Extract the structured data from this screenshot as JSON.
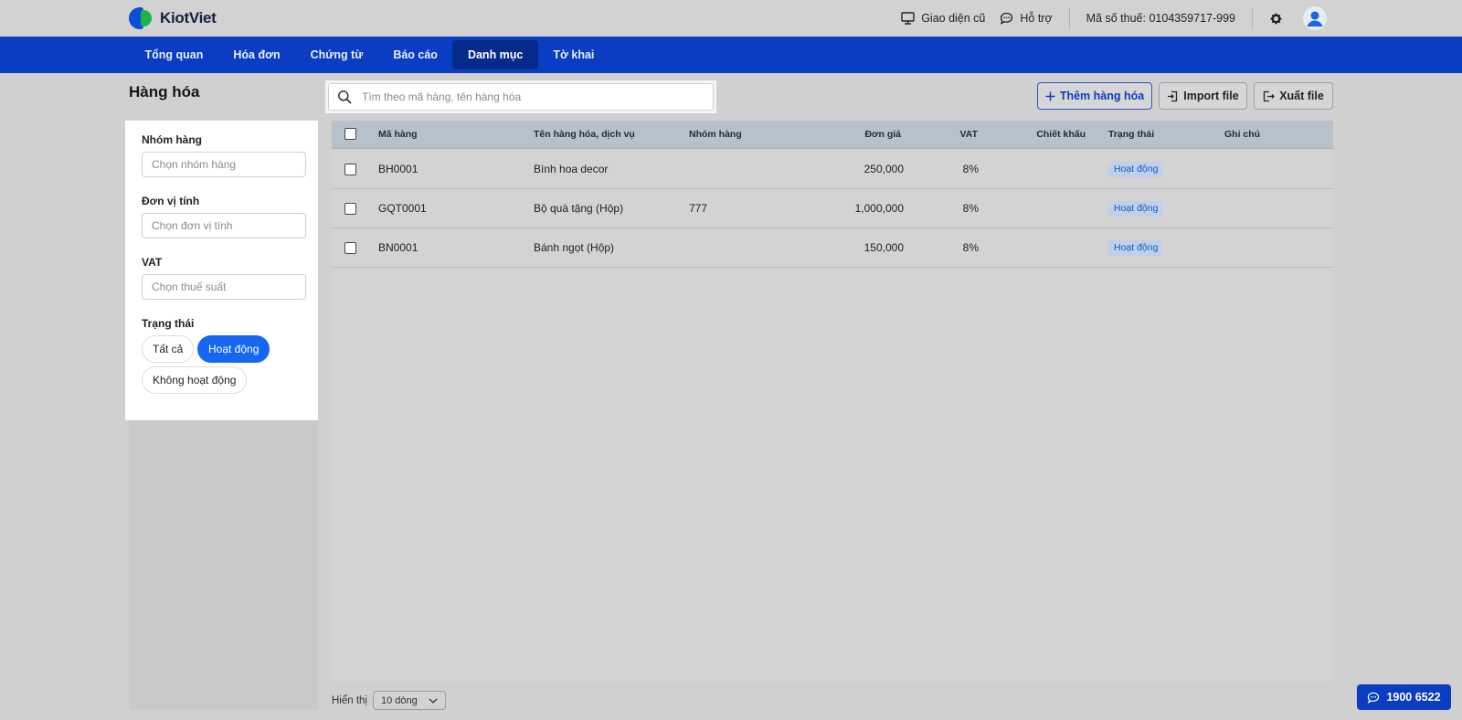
{
  "app": {
    "brand": "KiotViet",
    "brand_color": "#0a3dc2"
  },
  "header": {
    "legacy_ui_label": "Giao diện cũ",
    "support_label": "Hỗ trợ",
    "tax_code": "Mã số thuế: 0104359717-999"
  },
  "nav": {
    "items": [
      {
        "label": "Tổng quan"
      },
      {
        "label": "Hóa đơn"
      },
      {
        "label": "Chứng từ"
      },
      {
        "label": "Báo cáo"
      },
      {
        "label": "Danh mục",
        "active": true
      },
      {
        "label": "Tờ khai"
      }
    ]
  },
  "page": {
    "title": "Hàng hóa"
  },
  "search": {
    "placeholder": "Tìm theo mã hàng, tên hàng hóa",
    "value": ""
  },
  "actions": {
    "add_label": "Thêm hàng hóa",
    "import_label": "Import file",
    "export_label": "Xuất file"
  },
  "filters": {
    "group": {
      "label": "Nhóm hàng",
      "placeholder": "Chọn nhóm hàng"
    },
    "unit": {
      "label": "Đơn vị tính",
      "placeholder": "Chọn đơn vị tính"
    },
    "vat": {
      "label": "VAT",
      "placeholder": "Chọn thuế suất"
    },
    "status": {
      "label": "Trạng thái",
      "options": [
        {
          "label": "Tất cả"
        },
        {
          "label": "Hoạt động",
          "selected": true
        },
        {
          "label": "Không hoạt động"
        }
      ]
    }
  },
  "table": {
    "columns": {
      "code": "Mã hàng",
      "name": "Tên hàng hóa, dịch vụ",
      "group": "Nhóm hàng",
      "price": "Đơn giá",
      "vat": "VAT",
      "discount": "Chiết khấu",
      "status": "Trạng thái",
      "note": "Ghi chú"
    },
    "rows": [
      {
        "code": "BH0001",
        "name": "Bình hoa decor",
        "group": "",
        "price": "250,000",
        "vat": "8%",
        "discount": "",
        "status": "Hoạt động",
        "note": ""
      },
      {
        "code": "GQT0001",
        "name": "Bộ quà tặng (Hộp)",
        "group": "777",
        "price": "1,000,000",
        "vat": "8%",
        "discount": "",
        "status": "Hoạt động",
        "note": ""
      },
      {
        "code": "BN0001",
        "name": "Bánh ngọt (Hộp)",
        "group": "",
        "price": "150,000",
        "vat": "8%",
        "discount": "",
        "status": "Hoạt động",
        "note": ""
      }
    ]
  },
  "footer": {
    "show_label": "Hiển thị",
    "page_size": "10 dòng"
  },
  "hotline": {
    "number": "1900 6522"
  }
}
